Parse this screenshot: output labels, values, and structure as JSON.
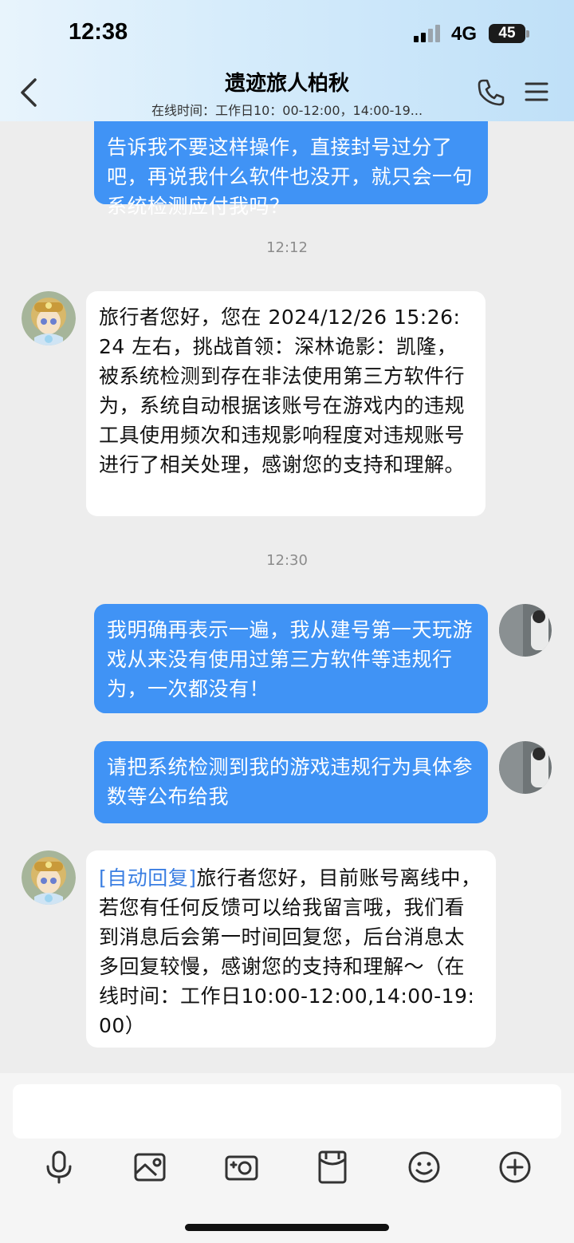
{
  "status_bar": {
    "time": "12:38",
    "network": "4G",
    "battery": "45"
  },
  "header": {
    "title": "遗迹旅人柏秋",
    "subtitle": "在线时间：工作日10：00-12:00，14:00-19..."
  },
  "messages": [
    {
      "from": "me",
      "text": "告诉我不要这样操作，直接封号过分了吧，再说我什么软件也没开，就只会一句系统检测应付我吗？"
    },
    {
      "time": "12:12"
    },
    {
      "from": "service",
      "text": "旅行者您好，您在 2024/12/26 15:26:24 左右，挑战首领：深林诡影：凯隆，被系统检测到存在非法使用第三方软件行为，系统自动根据该账号在游戏内的违规工具使用频次和违规影响程度对违规账号进行了相关处理，感谢您的支持和理解。"
    },
    {
      "time": "12:30"
    },
    {
      "from": "me",
      "text": "我明确再表示一遍，我从建号第一天玩游戏从来没有使用过第三方软件等违规行为，一次都没有！"
    },
    {
      "from": "me",
      "text": "请把系统检测到我的游戏违规行为具体参数等公布给我"
    },
    {
      "from": "service",
      "tag": "[自动回复]",
      "text": "旅行者您好，目前账号离线中，若您有任何反馈可以给我留言哦，我们看到消息后会第一时间回复您，后台消息太多回复较慢，感谢您的支持和理解～（在线时间：工作日10:00-12:00,14:00-19:00）"
    }
  ],
  "input": {
    "placeholder": ""
  },
  "toolbar": [
    "microphone-icon",
    "image-icon",
    "camera-icon",
    "red-packet-icon",
    "emoji-icon",
    "plus-icon"
  ],
  "colors": {
    "my_bubble": "#4093f5",
    "their_bubble": "#ffffff",
    "background": "#ededed",
    "auto_tag": "#3a7ee2"
  }
}
